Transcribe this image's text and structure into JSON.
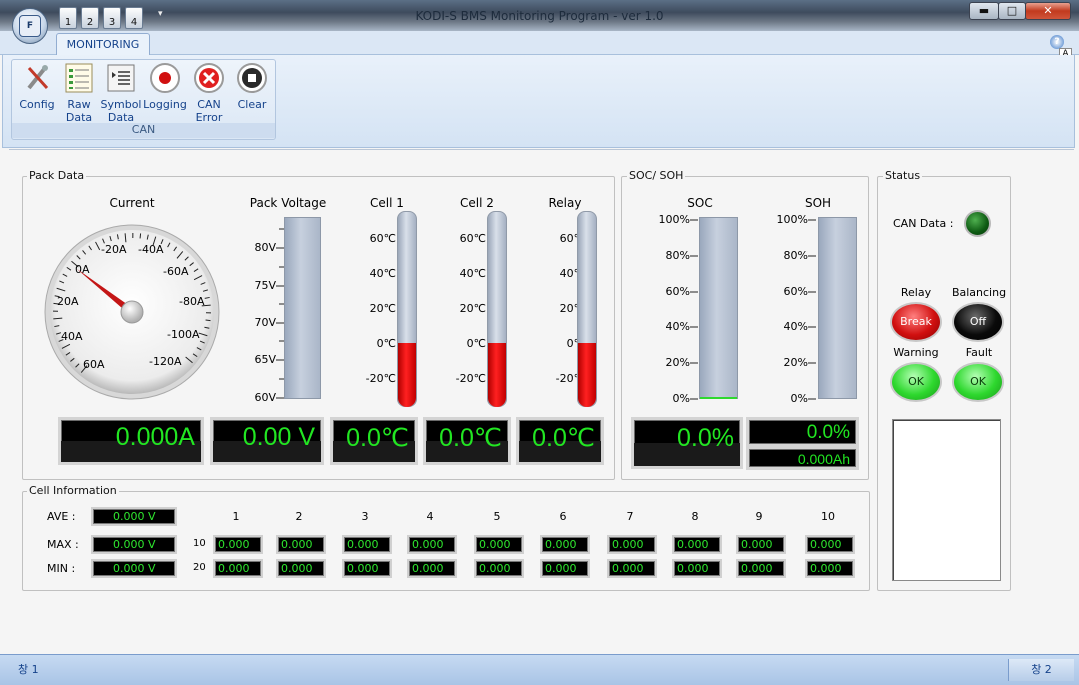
{
  "window": {
    "title": "KODI-S BMS Monitoring Program - ver 1.0",
    "app_icon": "F",
    "minimize": "▬",
    "maximize": "□",
    "close": "✕"
  },
  "qat": {
    "items": [
      "1",
      "2",
      "3",
      "4"
    ],
    "dropdown": "▾"
  },
  "ribbon": {
    "tab": "MONITORING",
    "help": "?",
    "a_button": "A",
    "group_label": "CAN",
    "buttons": [
      {
        "label1": "Config",
        "label2": "",
        "icon": "config-icon"
      },
      {
        "label1": "Raw",
        "label2": "Data",
        "icon": "raw-data-icon"
      },
      {
        "label1": "Symbol",
        "label2": "Data",
        "icon": "symbol-data-icon"
      },
      {
        "label1": "Logging",
        "label2": "",
        "icon": "record-icon"
      },
      {
        "label1": "CAN",
        "label2": "Error",
        "icon": "can-error-icon"
      },
      {
        "label1": "Clear",
        "label2": "",
        "icon": "stop-icon"
      }
    ]
  },
  "pack": {
    "group_label": "Pack Data",
    "current": {
      "label": "Current",
      "value": "0.000A",
      "gauge_ticks": [
        "0A",
        "-20A",
        "-40A",
        "-60A",
        "-80A",
        "-100A",
        "-120A",
        "60A",
        "40A",
        "20A"
      ],
      "needle_value_A": 0
    },
    "voltage": {
      "label": "Pack Voltage",
      "value": "0.00 V",
      "ticks": [
        "80V",
        "75V",
        "70V",
        "65V",
        "60V"
      ]
    },
    "cell1": {
      "label": "Cell 1",
      "value": "0.0℃"
    },
    "cell2": {
      "label": "Cell 2",
      "value": "0.0℃"
    },
    "relay": {
      "label": "Relay",
      "value": "0.0℃"
    },
    "temp_ticks": [
      "60℃",
      "40℃",
      "20℃",
      "0℃",
      "-20℃"
    ]
  },
  "soc_soh": {
    "group_label": "SOC/ SOH",
    "soc": {
      "label": "SOC",
      "value": "0.0%"
    },
    "soh": {
      "label": "SOH",
      "value": "0.0%",
      "capacity": "0.000Ah"
    },
    "ticks": [
      "100%",
      "80%",
      "60%",
      "40%",
      "20%",
      "0%"
    ]
  },
  "status": {
    "group_label": "Status",
    "can_data_label": "CAN Data :",
    "relay": {
      "label": "Relay",
      "state": "Break"
    },
    "balancing": {
      "label": "Balancing",
      "state": "Off"
    },
    "warning": {
      "label": "Warning",
      "state": "OK"
    },
    "fault": {
      "label": "Fault",
      "state": "OK"
    },
    "colors": {
      "red_led": "#d11010",
      "black_led": "#0a0a0a",
      "green_led": "#2ed82e",
      "can_led": "#0d5a12"
    }
  },
  "cell_info": {
    "group_label": "Cell Information",
    "ave_label": "AVE :",
    "ave_value": "0.000 V",
    "max_label": "MAX :",
    "max_value": "0.000 V",
    "min_label": "MIN :",
    "min_value": "0.000 V",
    "columns": [
      "1",
      "2",
      "3",
      "4",
      "5",
      "6",
      "7",
      "8",
      "9",
      "10"
    ],
    "row1_label": "10",
    "row2_label": "20",
    "row1": [
      "0.000",
      "0.000",
      "0.000",
      "0.000",
      "0.000",
      "0.000",
      "0.000",
      "0.000",
      "0.000",
      "0.000"
    ],
    "row2": [
      "0.000",
      "0.000",
      "0.000",
      "0.000",
      "0.000",
      "0.000",
      "0.000",
      "0.000",
      "0.000",
      "0.000"
    ]
  },
  "statusbar": {
    "left": "창 1",
    "right": "창 2"
  }
}
